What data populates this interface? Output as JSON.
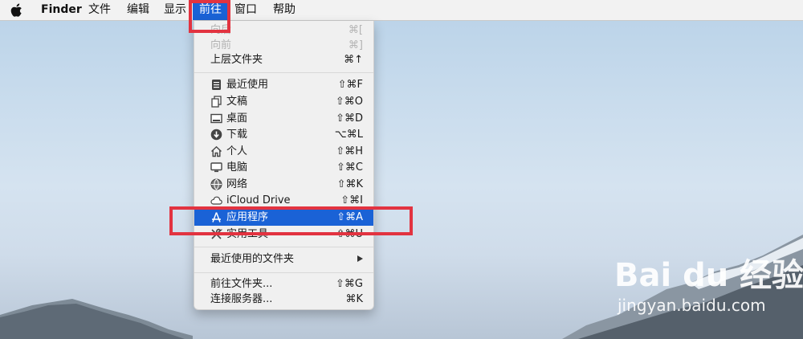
{
  "menubar": {
    "app": "Finder",
    "items": [
      "文件",
      "编辑",
      "显示",
      "前往",
      "窗口",
      "帮助"
    ]
  },
  "go_menu": {
    "back": {
      "label": "向后",
      "shortcut": "⌘["
    },
    "forward": {
      "label": "向前",
      "shortcut": "⌘]"
    },
    "enclosing": {
      "label": "上层文件夹",
      "shortcut": "⌘↑"
    },
    "places": [
      {
        "label": "最近使用",
        "shortcut": "⇧⌘F",
        "icon": "recents-icon"
      },
      {
        "label": "文稿",
        "shortcut": "⇧⌘O",
        "icon": "documents-icon"
      },
      {
        "label": "桌面",
        "shortcut": "⇧⌘D",
        "icon": "desktop-icon"
      },
      {
        "label": "下载",
        "shortcut": "⌥⌘L",
        "icon": "downloads-icon"
      },
      {
        "label": "个人",
        "shortcut": "⇧⌘H",
        "icon": "home-icon"
      },
      {
        "label": "电脑",
        "shortcut": "⇧⌘C",
        "icon": "computer-icon"
      },
      {
        "label": "网络",
        "shortcut": "⇧⌘K",
        "icon": "network-icon"
      },
      {
        "label": "iCloud Drive",
        "shortcut": "⇧⌘I",
        "icon": "icloud-icon"
      },
      {
        "label": "应用程序",
        "shortcut": "⇧⌘A",
        "icon": "applications-icon"
      },
      {
        "label": "实用工具",
        "shortcut": "⇧⌘U",
        "icon": "utilities-icon"
      }
    ],
    "recent_folders": {
      "label": "最近使用的文件夹"
    },
    "go_to_folder": {
      "label": "前往文件夹...",
      "shortcut": "⇧⌘G"
    },
    "connect_server": {
      "label": "连接服务器...",
      "shortcut": "⌘K"
    }
  },
  "watermark": {
    "brand": "Bai du 经验",
    "url": "jingyan.baidu.com"
  },
  "colors": {
    "selection": "#1a62d6",
    "highlight_annotation": "#e23340"
  }
}
